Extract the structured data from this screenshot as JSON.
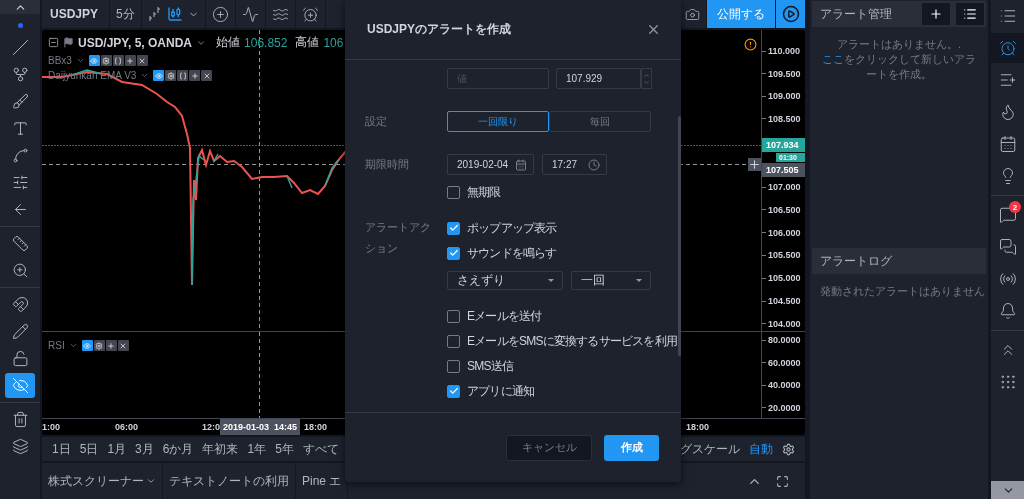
{
  "left_toolbar": {
    "tools": [
      {
        "selected": false
      },
      {
        "selected": false
      },
      {
        "selected": false
      },
      {
        "selected": false
      },
      {
        "selected": false
      },
      {
        "selected": false
      },
      {
        "selected": false
      },
      {
        "selected": false
      },
      {
        "selected": false
      },
      {
        "selected": false
      },
      {
        "selected": false
      },
      {
        "selected": false
      },
      {
        "selected": true
      },
      {
        "selected": false
      },
      {
        "selected": false
      }
    ]
  },
  "top_toolbar": {
    "symbol": "USDJPY",
    "interval": "5分",
    "publish_button": "公開する"
  },
  "chart": {
    "legend": {
      "title": "USD/JPY, 5, OANDA",
      "open_label": "始値",
      "open_value": "106.852",
      "high_label": "高値",
      "high_value": "106"
    },
    "indicators": [
      {
        "name": "BBx3"
      },
      {
        "name": "Daijyunkan EMA V3"
      }
    ],
    "rsi": {
      "name": "RSI"
    },
    "price_ticks_upper": [
      "110.000",
      "109.500",
      "109.000",
      "108.500"
    ],
    "price_ticks_lower": [
      "107.000",
      "106.500",
      "106.000",
      "105.500",
      "105.000",
      "104.500",
      "104.000"
    ],
    "last_price": "107.934",
    "countdown": "01:30",
    "crosshair_price": "107.505",
    "rsi_ticks": [
      "80.0000",
      "60.0000",
      "40.0000",
      "20.0000"
    ],
    "time_ticks": [
      "1:00",
      "06:00",
      "12:0",
      "18:00",
      "18:00"
    ],
    "crosshair_time": "2019-01-03  14:45"
  },
  "range_bar": {
    "ranges": [
      "1日",
      "5日",
      "1月",
      "3月",
      "6か月",
      "年初来",
      "1年",
      "5年",
      "すべて"
    ],
    "log_scale": "グスケール",
    "auto": "自動"
  },
  "bottom_tabs": [
    {
      "label": "株式スクリーナー",
      "dropdown": true
    },
    {
      "label": "テキストノートの利用",
      "dropdown": false
    },
    {
      "label": "Pine エ",
      "dropdown": false
    }
  ],
  "dialog": {
    "title": "USDJPYのアラートを作成",
    "value_placeholder": "値",
    "value": "107.929",
    "setting_label": "設定",
    "frequency": [
      {
        "label": "一回限り",
        "selected": true
      },
      {
        "label": "毎回",
        "selected": false
      }
    ],
    "expiry_label": "期限時間",
    "date": "2019-02-04",
    "time": "17:27",
    "no_expiry": {
      "label": "無期限",
      "checked": false
    },
    "action_label": "アラートアクション",
    "actions": [
      {
        "kind": "checkbox",
        "label": "ポップアップ表示",
        "checked": true
      },
      {
        "kind": "checkbox",
        "label": "サウンドを鳴らす",
        "checked": true
      },
      {
        "kind": "selects",
        "sound": "さえずり",
        "repeat": "一回"
      },
      {
        "kind": "checkbox",
        "label": "Eメールを送付",
        "checked": false
      },
      {
        "kind": "checkbox",
        "label": "EメールをSMSに変換するサービスを利用",
        "checked": false
      },
      {
        "kind": "checkbox",
        "label": "SMS送信",
        "checked": false
      },
      {
        "kind": "checkbox",
        "label": "アプリに通知",
        "checked": true
      }
    ],
    "cancel_button": "キャンセル",
    "create_button": "作成"
  },
  "alert_panel": {
    "title": "アラート管理",
    "empty_message": "アラートはありません。.",
    "link": "ここ",
    "hint": "をクリックして新しいアラートを作成。",
    "log_title": "アラートログ",
    "log_empty": "発動されたアラートはありません"
  },
  "right_toolbar": {
    "items": [
      {
        "selected": false
      },
      {
        "selected": true
      },
      {
        "selected": false
      },
      {
        "selected": false
      },
      {
        "selected": false
      },
      {
        "selected": false
      },
      {
        "selected": false,
        "badge": "2"
      },
      {
        "selected": false
      },
      {
        "selected": false
      },
      {
        "selected": false
      },
      {
        "selected": false
      },
      {
        "selected": false
      }
    ]
  }
}
